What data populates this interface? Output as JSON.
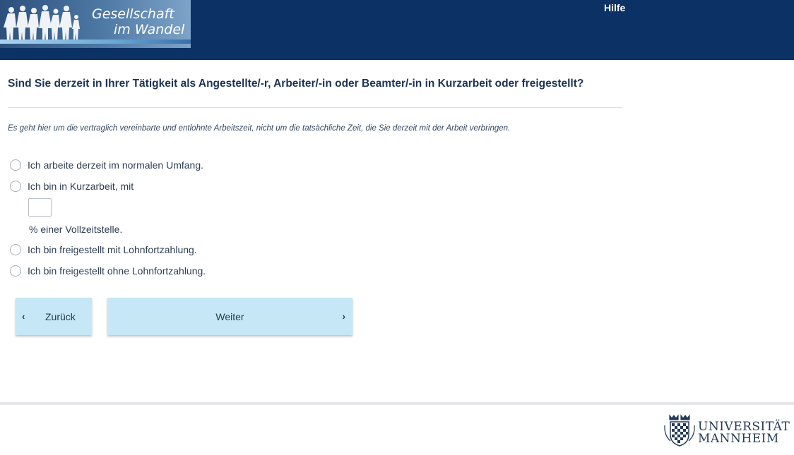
{
  "header": {
    "logo_line1": "Gesellschaft",
    "logo_line2": "im Wandel",
    "help_label": "Hilfe"
  },
  "question": {
    "title": "Sind Sie derzeit in Ihrer Tätigkeit als Angestellte/-r, Arbeiter/-in oder Beamter/-in in Kurzarbeit oder freigestellt?",
    "note": "Es geht hier um die vertraglich vereinbarte und entlohnte Arbeitszeit, nicht um die tatsächliche Zeit, die Sie derzeit mit der Arbeit verbringen."
  },
  "options": [
    {
      "label": "Ich arbeite derzeit im normalen Umfang.",
      "selected": false
    },
    {
      "label": "Ich bin in Kurzarbeit, mit",
      "selected": false
    },
    {
      "label": "Ich bin freigestellt mit Lohnfortzahlung.",
      "selected": false
    },
    {
      "label": "Ich bin freigestellt ohne Lohnfortzahlung.",
      "selected": false
    }
  ],
  "percent_field": {
    "value": "",
    "suffix": "% einer Vollzeitstelle."
  },
  "nav": {
    "back_label": "Zurück",
    "next_label": "Weiter",
    "back_icon": "chevron-left-icon",
    "next_icon": "chevron-right-icon"
  },
  "footer": {
    "uni_line1": "UNIVERSITÄT",
    "uni_line2": "MANNHEIM"
  },
  "colors": {
    "header_bg": "#0c3165",
    "button_bg": "#c6e7f5",
    "text": "#1d3354"
  }
}
